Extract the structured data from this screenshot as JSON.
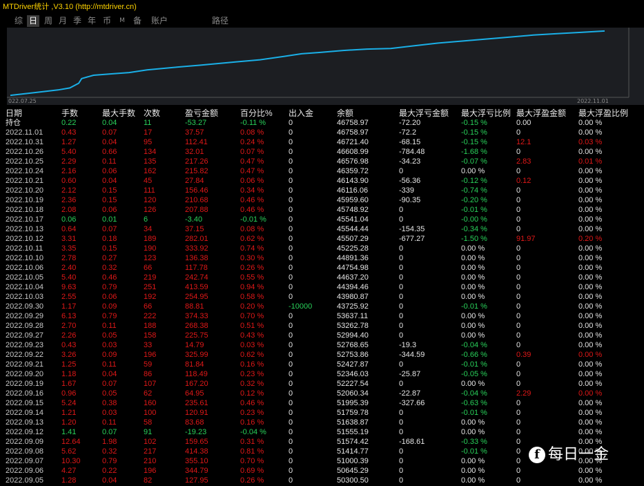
{
  "window": {
    "title": "MTDriver统计 ,V3.10 (http://mtdriver.cn)"
  },
  "tabs": [
    {
      "label": "综",
      "active": false,
      "small": false
    },
    {
      "label": "日",
      "active": true,
      "small": false
    },
    {
      "label": "周",
      "active": false,
      "small": false
    },
    {
      "label": "月",
      "active": false,
      "small": false
    },
    {
      "label": "季",
      "active": false,
      "small": false
    },
    {
      "label": "年",
      "active": false,
      "small": false
    },
    {
      "label": "币",
      "active": false,
      "small": false
    },
    {
      "label": "M",
      "active": false,
      "small": true
    },
    {
      "label": "备",
      "active": false,
      "small": false
    },
    {
      "label": "账户",
      "active": false,
      "small": false
    },
    {
      "label": "路径",
      "active": false,
      "small": false
    }
  ],
  "chart_data": {
    "type": "line",
    "start_label": "022.07.25",
    "end_label": "2022.11.01",
    "color": "#1ab0e8",
    "x_range": [
      0,
      1
    ],
    "y_range": [
      0,
      1
    ],
    "points": [
      [
        0,
        0.02
      ],
      [
        0.04,
        0.06
      ],
      [
        0.08,
        0.1
      ],
      [
        0.1,
        0.13
      ],
      [
        0.115,
        0.2
      ],
      [
        0.12,
        0.27
      ],
      [
        0.14,
        0.32
      ],
      [
        0.17,
        0.34
      ],
      [
        0.2,
        0.36
      ],
      [
        0.23,
        0.4
      ],
      [
        0.28,
        0.44
      ],
      [
        0.32,
        0.47
      ],
      [
        0.38,
        0.52
      ],
      [
        0.42,
        0.55
      ],
      [
        0.46,
        0.6
      ],
      [
        0.49,
        0.64
      ],
      [
        0.52,
        0.66
      ],
      [
        0.56,
        0.69
      ],
      [
        0.6,
        0.71
      ],
      [
        0.64,
        0.72
      ],
      [
        0.68,
        0.76
      ],
      [
        0.72,
        0.8
      ],
      [
        0.76,
        0.83
      ],
      [
        0.8,
        0.86
      ],
      [
        0.84,
        0.89
      ],
      [
        0.88,
        0.92
      ],
      [
        0.92,
        0.94
      ],
      [
        0.96,
        0.96
      ],
      [
        1,
        0.98
      ]
    ]
  },
  "columns": [
    "日期",
    "手数",
    "最大手数",
    "次数",
    "盈亏金额",
    "百分比%",
    "出入金",
    "余额",
    "最大浮亏金额",
    "最大浮亏比例",
    "最大浮盈金额",
    "最大浮盈比例"
  ],
  "colors": {
    "red": "#e01818",
    "green": "#29d15a",
    "white": "#e6e6e6"
  },
  "rows": [
    {
      "c": [
        "持仓",
        "0.22",
        "0.04",
        "11",
        "-53.27",
        "-0.11 %",
        "0",
        "46758.97",
        "-72.20",
        "-0.15 %",
        "0.00",
        "0.00 %"
      ],
      "k": "gggggg0w0g00"
    },
    {
      "c": [
        "2022.11.01",
        "0.43",
        "0.07",
        "17",
        "37.57",
        "0.08 %",
        "0",
        "46758.97",
        "-72.2",
        "-0.15 %",
        "0",
        "0.00 %"
      ],
      "k": "rrrrrr0w0g00"
    },
    {
      "c": [
        "2022.10.31",
        "1.27",
        "0.04",
        "95",
        "112.41",
        "0.24 %",
        "0",
        "46721.40",
        "-68.15",
        "-0.15 %",
        "12.1",
        "0.03 %"
      ],
      "k": "rrrrrr0w0grr"
    },
    {
      "c": [
        "2022.10.26",
        "5.40",
        "0.66",
        "134",
        "32.01",
        "0.07 %",
        "0",
        "46608.99",
        "-784.48",
        "-1.68 %",
        "0",
        "0.00 %"
      ],
      "k": "rrrrrr0w0g00"
    },
    {
      "c": [
        "2022.10.25",
        "2.29",
        "0.11",
        "135",
        "217.26",
        "0.47 %",
        "0",
        "46576.98",
        "-34.23",
        "-0.07 %",
        "2.83",
        "0.01 %"
      ],
      "k": "rrrrrr0w0grr"
    },
    {
      "c": [
        "2022.10.24",
        "2.16",
        "0.06",
        "162",
        "215.82",
        "0.47 %",
        "0",
        "46359.72",
        "0",
        "0.00 %",
        "0",
        "0.00 %"
      ],
      "k": "rrrrrr0w0000"
    },
    {
      "c": [
        "2022.10.21",
        "0.60",
        "0.04",
        "45",
        "27.84",
        "0.06 %",
        "0",
        "46143.90",
        "-56.36",
        "-0.12 %",
        "0.12",
        "0.00 %"
      ],
      "k": "rrrrrr0w0gr0"
    },
    {
      "c": [
        "2022.10.20",
        "2.12",
        "0.15",
        "111",
        "156.46",
        "0.34 %",
        "0",
        "46116.06",
        "-339",
        "-0.74 %",
        "0",
        "0.00 %"
      ],
      "k": "rrrrrr0w0g00"
    },
    {
      "c": [
        "2022.10.19",
        "2.36",
        "0.15",
        "120",
        "210.68",
        "0.46 %",
        "0",
        "45959.60",
        "-90.35",
        "-0.20 %",
        "0",
        "0.00 %"
      ],
      "k": "rrrrrr0w0g00"
    },
    {
      "c": [
        "2022.10.18",
        "2.08",
        "0.06",
        "126",
        "207.88",
        "0.46 %",
        "0",
        "45748.92",
        "0",
        "-0.01 %",
        "0",
        "0.00 %"
      ],
      "k": "rrrrrr0w0g00"
    },
    {
      "c": [
        "2022.10.17",
        "0.06",
        "0.01",
        "6",
        "-3.40",
        "-0.01 %",
        "0",
        "45541.04",
        "0",
        "-0.00 %",
        "0",
        "0.00 %"
      ],
      "k": "gggggg0w0g00"
    },
    {
      "c": [
        "2022.10.13",
        "0.64",
        "0.07",
        "34",
        "37.15",
        "0.08 %",
        "0",
        "45544.44",
        "-154.35",
        "-0.34 %",
        "0",
        "0.00 %"
      ],
      "k": "rrrrrr0w0g00"
    },
    {
      "c": [
        "2022.10.12",
        "3.31",
        "0.18",
        "189",
        "282.01",
        "0.62 %",
        "0",
        "45507.29",
        "-677.27",
        "-1.50 %",
        "91.97",
        "0.20 %"
      ],
      "k": "rrrrrr0w0grr"
    },
    {
      "c": [
        "2022.10.11",
        "3.35",
        "0.15",
        "190",
        "333.92",
        "0.74 %",
        "0",
        "45225.28",
        "0",
        "0.00 %",
        "0",
        "0.00 %"
      ],
      "k": "rrrrrr0w0000"
    },
    {
      "c": [
        "2022.10.10",
        "2.78",
        "0.27",
        "123",
        "136.38",
        "0.30 %",
        "0",
        "44891.36",
        "0",
        "0.00 %",
        "0",
        "0.00 %"
      ],
      "k": "rrrrrr0w0000"
    },
    {
      "c": [
        "2022.10.06",
        "2.40",
        "0.32",
        "66",
        "117.78",
        "0.26 %",
        "0",
        "44754.98",
        "0",
        "0.00 %",
        "0",
        "0.00 %"
      ],
      "k": "rrrrrr0w0000"
    },
    {
      "c": [
        "2022.10.05",
        "5.40",
        "0.46",
        "219",
        "242.74",
        "0.55 %",
        "0",
        "44637.20",
        "0",
        "0.00 %",
        "0",
        "0.00 %"
      ],
      "k": "rrrrrr0w0000"
    },
    {
      "c": [
        "2022.10.04",
        "9.63",
        "0.79",
        "251",
        "413.59",
        "0.94 %",
        "0",
        "44394.46",
        "0",
        "0.00 %",
        "0",
        "0.00 %"
      ],
      "k": "rrrrrr0w0000"
    },
    {
      "c": [
        "2022.10.03",
        "2.55",
        "0.06",
        "192",
        "254.95",
        "0.58 %",
        "0",
        "43980.87",
        "0",
        "0.00 %",
        "0",
        "0.00 %"
      ],
      "k": "rrrrrr0w0000"
    },
    {
      "c": [
        "2022.09.30",
        "1.17",
        "0.09",
        "66",
        "88.81",
        "0.20 %",
        "-10000",
        "43725.92",
        "0",
        "-0.01 %",
        "0",
        "0.00 %"
      ],
      "k": "rrrrrrgw0g00"
    },
    {
      "c": [
        "2022.09.29",
        "6.13",
        "0.79",
        "222",
        "374.33",
        "0.70 %",
        "0",
        "53637.11",
        "0",
        "0.00 %",
        "0",
        "0.00 %"
      ],
      "k": "rrrrrr0w0000"
    },
    {
      "c": [
        "2022.09.28",
        "2.70",
        "0.11",
        "188",
        "268.38",
        "0.51 %",
        "0",
        "53262.78",
        "0",
        "0.00 %",
        "0",
        "0.00 %"
      ],
      "k": "rrrrrr0w0000"
    },
    {
      "c": [
        "2022.09.27",
        "2.26",
        "0.05",
        "158",
        "225.75",
        "0.43 %",
        "0",
        "52994.40",
        "0",
        "0.00 %",
        "0",
        "0.00 %"
      ],
      "k": "rrrrrr0w0000"
    },
    {
      "c": [
        "2022.09.23",
        "0.43",
        "0.03",
        "33",
        "14.79",
        "0.03 %",
        "0",
        "52768.65",
        "-19.3",
        "-0.04 %",
        "0",
        "0.00 %"
      ],
      "k": "rrrrrr0w0g00"
    },
    {
      "c": [
        "2022.09.22",
        "3.26",
        "0.09",
        "196",
        "325.99",
        "0.62 %",
        "0",
        "52753.86",
        "-344.59",
        "-0.66 %",
        "0.39",
        "0.00 %"
      ],
      "k": "rrrrrr0w0grr"
    },
    {
      "c": [
        "2022.09.21",
        "1.25",
        "0.11",
        "59",
        "81.84",
        "0.16 %",
        "0",
        "52427.87",
        "0",
        "-0.01 %",
        "0",
        "0.00 %"
      ],
      "k": "rrrrrr0w0g00"
    },
    {
      "c": [
        "2022.09.20",
        "1.18",
        "0.04",
        "86",
        "118.49",
        "0.23 %",
        "0",
        "52346.03",
        "-25.87",
        "-0.05 %",
        "0",
        "0.00 %"
      ],
      "k": "rrrrrr0w0g00"
    },
    {
      "c": [
        "2022.09.19",
        "1.67",
        "0.07",
        "107",
        "167.20",
        "0.32 %",
        "0",
        "52227.54",
        "0",
        "0.00 %",
        "0",
        "0.00 %"
      ],
      "k": "rrrrrr0w0000"
    },
    {
      "c": [
        "2022.09.16",
        "0.96",
        "0.05",
        "62",
        "64.95",
        "0.12 %",
        "0",
        "52060.34",
        "-22.87",
        "-0.04 %",
        "2.29",
        "0.00 %"
      ],
      "k": "rrrrrr0w0grr"
    },
    {
      "c": [
        "2022.09.15",
        "5.24",
        "0.38",
        "160",
        "235.61",
        "0.46 %",
        "0",
        "51995.39",
        "-327.66",
        "-0.63 %",
        "0",
        "0.00 %"
      ],
      "k": "rrrrrr0w0g00"
    },
    {
      "c": [
        "2022.09.14",
        "1.21",
        "0.03",
        "100",
        "120.91",
        "0.23 %",
        "0",
        "51759.78",
        "0",
        "-0.01 %",
        "0",
        "0.00 %"
      ],
      "k": "rrrrrr0w0g00"
    },
    {
      "c": [
        "2022.09.13",
        "1.20",
        "0.11",
        "58",
        "83.68",
        "0.16 %",
        "0",
        "51638.87",
        "0",
        "0.00 %",
        "0",
        "0.00 %"
      ],
      "k": "rrrrrr0w0000"
    },
    {
      "c": [
        "2022.09.12",
        "1.41",
        "0.07",
        "91",
        "-19.23",
        "-0.04 %",
        "0",
        "51555.19",
        "0",
        "0.00 %",
        "0",
        "0.00 %"
      ],
      "k": "gggggg0w0000"
    },
    {
      "c": [
        "2022.09.09",
        "12.64",
        "1.98",
        "102",
        "159.65",
        "0.31 %",
        "0",
        "51574.42",
        "-168.61",
        "-0.33 %",
        "0",
        "0.00 %"
      ],
      "k": "rrrrrr0w0g00"
    },
    {
      "c": [
        "2022.09.08",
        "5.62",
        "0.32",
        "217",
        "414.38",
        "0.81 %",
        "0",
        "51414.77",
        "0",
        "-0.01 %",
        "0",
        "0.00 %"
      ],
      "k": "rrrrrr0w0g00"
    },
    {
      "c": [
        "2022.09.07",
        "10.30",
        "0.79",
        "210",
        "355.10",
        "0.70 %",
        "0",
        "51000.39",
        "0",
        "0.00 %",
        "0",
        "0.00 %"
      ],
      "k": "rrrrrr0w0000"
    },
    {
      "c": [
        "2022.09.06",
        "4.27",
        "0.22",
        "196",
        "344.79",
        "0.69 %",
        "0",
        "50645.29",
        "0",
        "0.00 %",
        "0",
        "0.00 %"
      ],
      "k": "rrrrrr0w0000"
    },
    {
      "c": [
        "2022.09.05",
        "1.28",
        "0.04",
        "82",
        "127.95",
        "0.26 %",
        "0",
        "50300.50",
        "0",
        "0.00 %",
        "0",
        "0.00 %"
      ],
      "k": "rrrrrr0w0000"
    }
  ],
  "watermark": {
    "icon": "facebook-icon",
    "text": "每日一金"
  }
}
